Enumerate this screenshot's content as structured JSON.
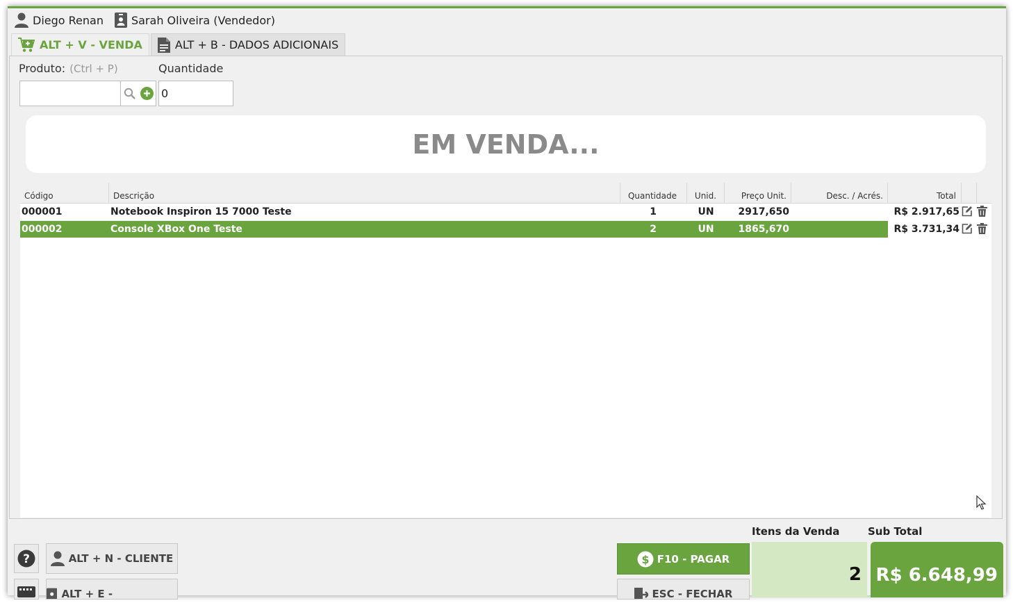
{
  "users": {
    "operator": "Diego Renan",
    "seller": "Sarah Oliveira (Vendedor)"
  },
  "tabs": [
    {
      "label": "ALT + V - VENDA",
      "active": true
    },
    {
      "label": "ALT + B - DADOS ADICIONAIS",
      "active": false
    }
  ],
  "form": {
    "product_label": "Produto:",
    "product_hint": "(Ctrl + P)",
    "product_value": "",
    "quantity_label": "Quantidade",
    "quantity_value": "0"
  },
  "status_banner": "EM VENDA...",
  "table": {
    "columns": [
      "Código",
      "Descrição",
      "Quantidade",
      "Unid.",
      "Preço Unit.",
      "Desc. / Acrés.",
      "Total"
    ],
    "rows": [
      {
        "code": "000001",
        "description": "Notebook Inspiron 15 7000 Teste",
        "quantity": "1",
        "unit": "UN",
        "unit_price": "2917,650",
        "discount": "",
        "total": "R$ 2.917,65",
        "selected": false
      },
      {
        "code": "000002",
        "description": "Console XBox One Teste",
        "quantity": "2",
        "unit": "UN",
        "unit_price": "1865,670",
        "discount": "",
        "total": "R$ 3.731,34",
        "selected": true
      }
    ]
  },
  "footer": {
    "cliente_label": "ALT + N - CLIENTE",
    "vendedor_label": "ALT + E - VENDEDOR",
    "pagar_label": "F10 - PAGAR",
    "fechar_label": "ESC - FECHAR",
    "itens_label": "Itens da Venda",
    "itens_value": "2",
    "subtotal_label": "Sub Total",
    "subtotal_value": "R$ 6.648,99"
  },
  "colors": {
    "accent": "#6aa43e",
    "accent_light": "#d4e8c4"
  }
}
